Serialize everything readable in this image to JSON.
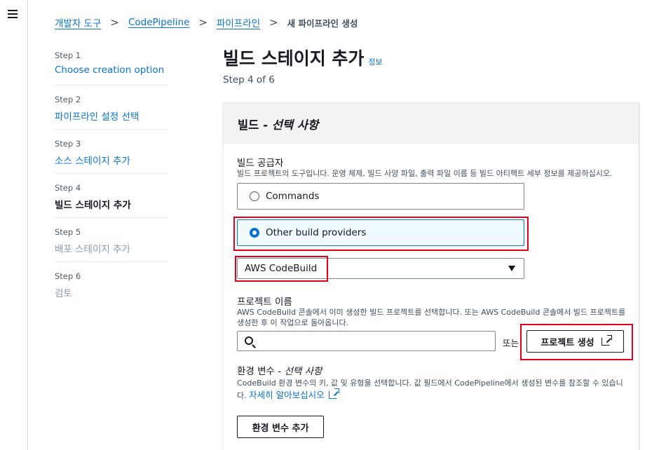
{
  "breadcrumb": {
    "items": [
      "개발자 도구",
      "CodePipeline",
      "파이프라인"
    ],
    "current": "새 파이프라인 생성",
    "separator": ">"
  },
  "steps": [
    {
      "num": "Step 1",
      "title": "Choose creation option",
      "state": "link"
    },
    {
      "num": "Step 2",
      "title": "파이프라인 설정 선택",
      "state": "link"
    },
    {
      "num": "Step 3",
      "title": "소스 스테이지 추가",
      "state": "link"
    },
    {
      "num": "Step 4",
      "title": "빌드 스테이지 추가",
      "state": "active"
    },
    {
      "num": "Step 5",
      "title": "배포 스테이지 추가",
      "state": "disabled"
    },
    {
      "num": "Step 6",
      "title": "검토",
      "state": "disabled"
    }
  ],
  "page": {
    "title": "빌드 스테이지 추가",
    "info": "정보",
    "step_count": "Step 4 of 6"
  },
  "panel": {
    "title": "빌드 - ",
    "title_optional": "선택 사항"
  },
  "build_provider": {
    "label": "빌드 공급자",
    "description": "빌드 프로젝트의 도구입니다. 운영 체제, 빌드 사양 파일, 출력 파일 이름 등 빌드 아티팩트 세부 정보를 제공하십시오.",
    "options": [
      {
        "label": "Commands",
        "selected": false
      },
      {
        "label": "Other build providers",
        "selected": true
      }
    ],
    "selected_provider": "AWS CodeBuild"
  },
  "project_name": {
    "label": "프로젝트 이름",
    "description": "AWS CodeBuild 콘솔에서 이미 생성한 빌드 프로젝트를 선택합니다. 또는 AWS CodeBuild 콘솔에서 빌드 프로젝트를 생성한 후 이 작업으로 돌아옵니다.",
    "search_value": "",
    "or_text": "또는",
    "create_button": "프로젝트 생성"
  },
  "env_vars": {
    "label": "환경 변수 - ",
    "label_optional": "선택 사항",
    "description": "CodeBuild 환경 변수의 키, 값 및 유형을 선택합니다. 값 필드에서 CodePipeline에서 생성된 변수를 참조할 수 있습니다.",
    "learn_more": "자세히 알아보십시오",
    "add_button": "환경 변수 추가"
  },
  "colors": {
    "link": "#0972d3",
    "highlight": "#e4001a",
    "selected_bg": "#f0fbff"
  }
}
